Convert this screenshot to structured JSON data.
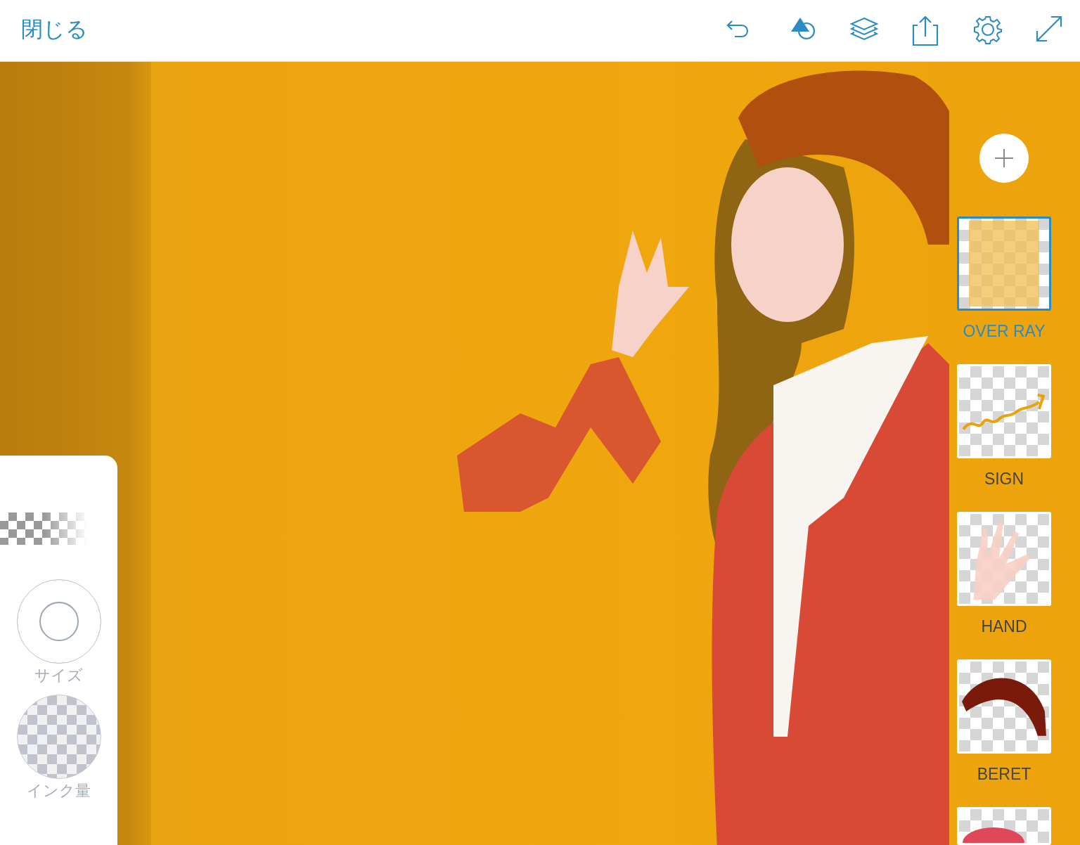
{
  "toolbar": {
    "close_label": "閉じる",
    "tools": [
      {
        "kind": "undo"
      },
      {
        "kind": "shapes"
      },
      {
        "kind": "layers"
      },
      {
        "kind": "share"
      },
      {
        "kind": "settings"
      },
      {
        "kind": "fullscreen"
      }
    ]
  },
  "tool_panel": {
    "controls": [
      {
        "kind": "size",
        "label": "サイズ"
      },
      {
        "kind": "ink",
        "label": "インク量"
      }
    ]
  },
  "layers": [
    {
      "name": "OVER RAY",
      "kind": "overlay",
      "selected": true
    },
    {
      "name": "SIGN",
      "kind": "sign",
      "selected": false
    },
    {
      "name": "HAND",
      "kind": "hand",
      "selected": false
    },
    {
      "name": "BERET",
      "kind": "beret",
      "selected": false
    },
    {
      "kind": "partial",
      "selected": false
    }
  ]
}
